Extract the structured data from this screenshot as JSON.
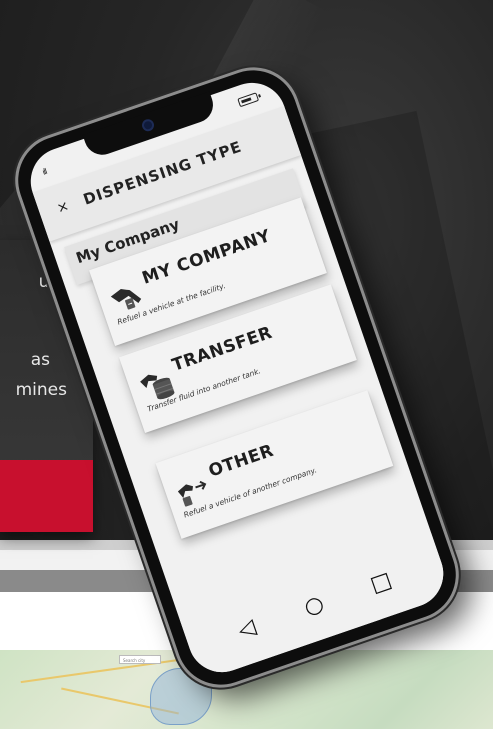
{
  "tooltip": {
    "line1": "ugh",
    "line2": "as",
    "line3": "mines"
  },
  "phone": {
    "title": "DISPENSING TYPE",
    "close_label": "×",
    "section_label": "My Company",
    "options": [
      {
        "label": "MY COMPANY",
        "description": "Refuel a vehicle at the facility.",
        "icon": "fuel-nozzle-icon"
      },
      {
        "label": "TRANSFER",
        "description": "Transfer fluid into another tank.",
        "icon": "fuel-barrel-icon"
      },
      {
        "label": "OTHER",
        "description": "Refuel a vehicle of another company.",
        "icon": "fuel-nozzle-arrow-icon"
      }
    ],
    "nav": {
      "back": "◁",
      "home": "○",
      "recent": "□"
    }
  },
  "map": {
    "search_placeholder": "Search city"
  },
  "colors": {
    "accent": "#c8102e",
    "panel": "#333333"
  }
}
